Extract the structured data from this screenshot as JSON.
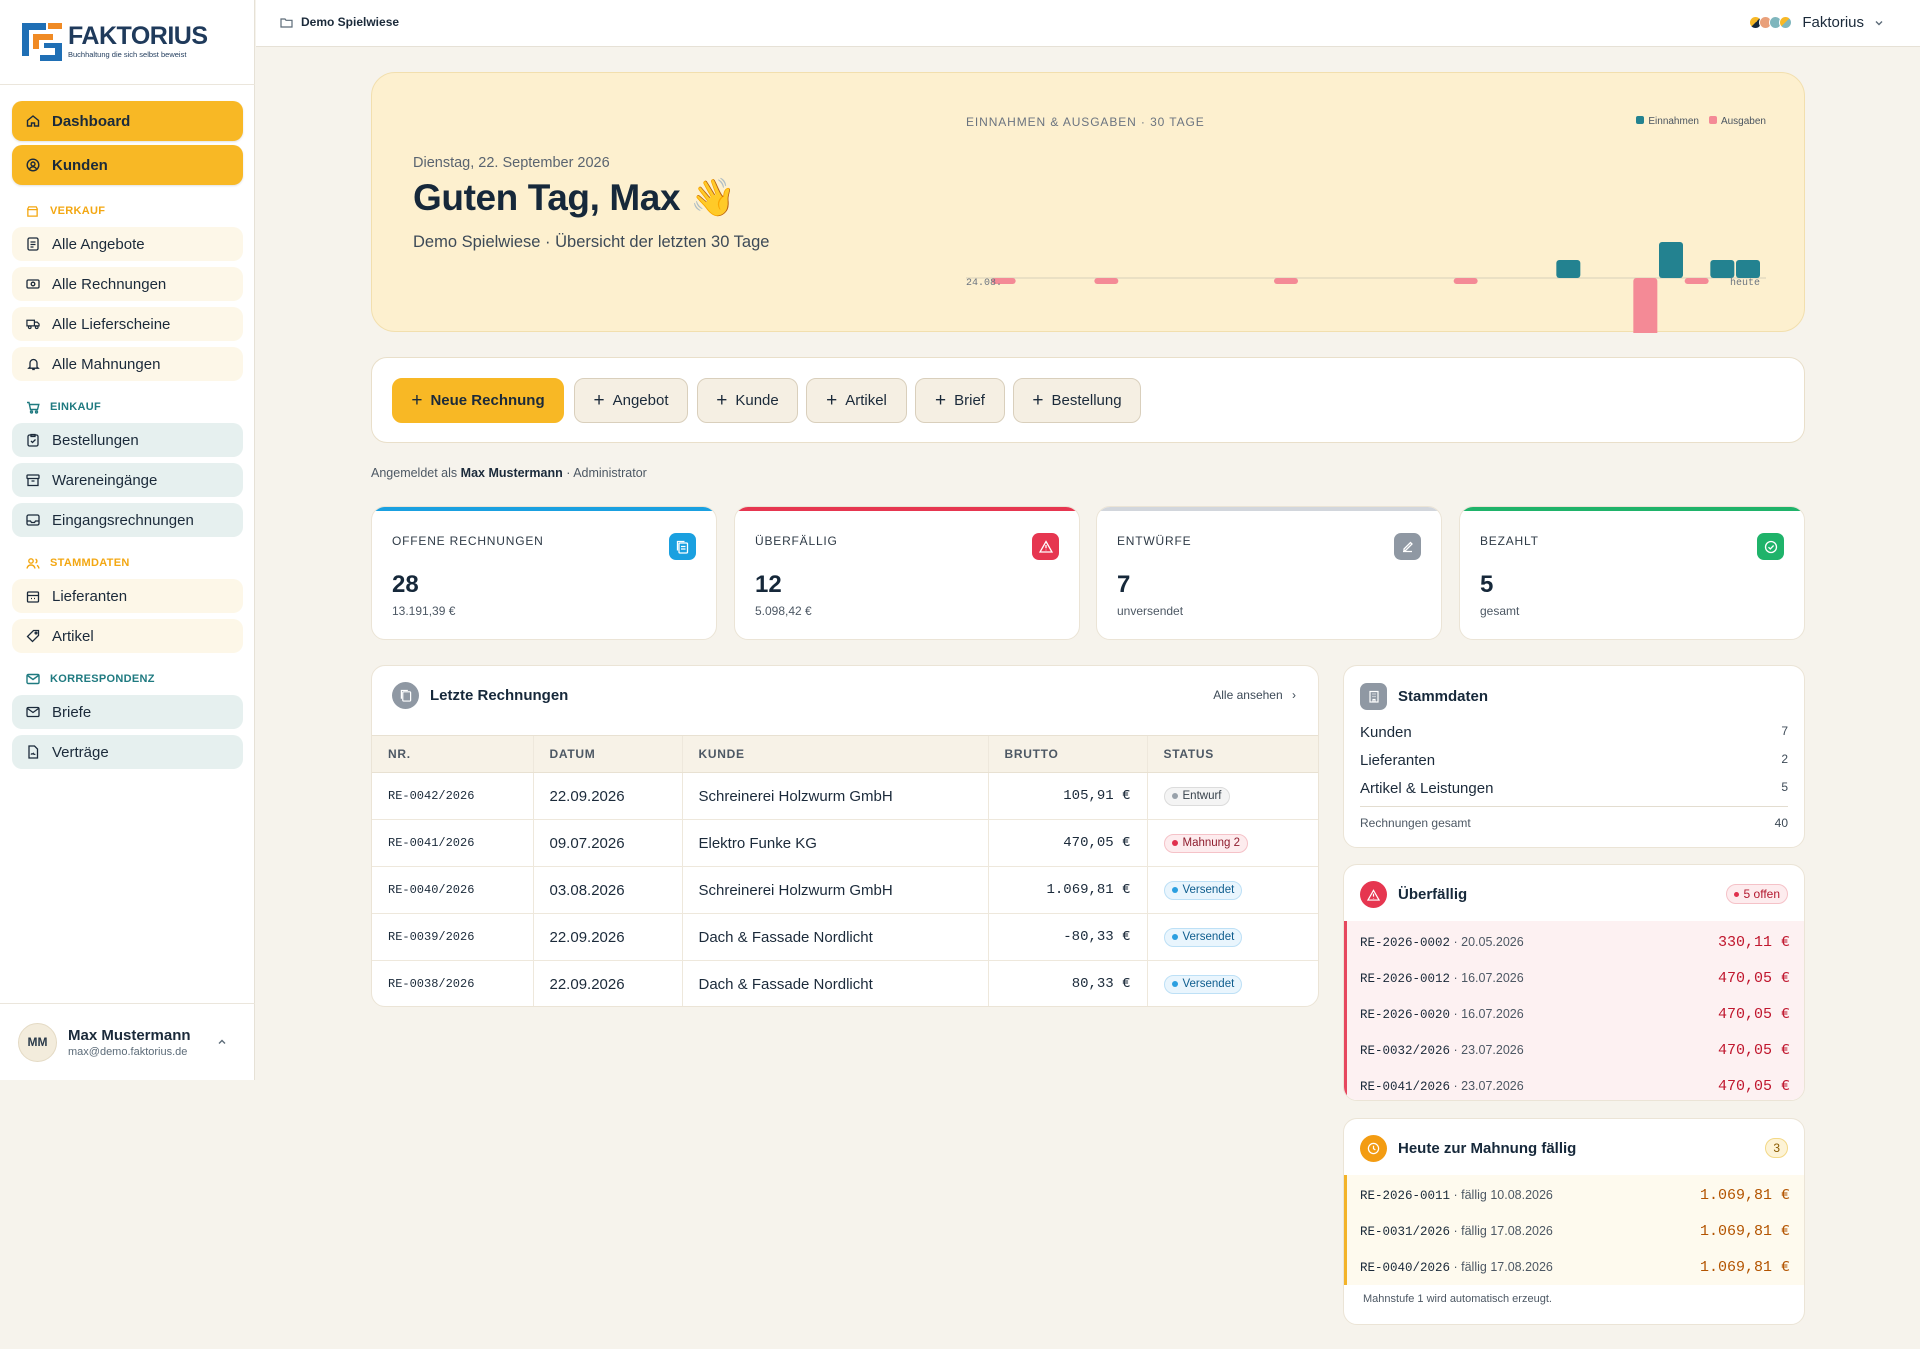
{
  "brand": {
    "name": "FAKTORIUS",
    "tagline": "Buchhaltung die sich selbst beweist"
  },
  "sidebar": {
    "top_items": [
      {
        "label": "Dashboard",
        "icon": "home-icon"
      },
      {
        "label": "Kunden",
        "icon": "user-circle-icon"
      }
    ],
    "sections": [
      {
        "title": "VERKAUF",
        "color": "#f3a712",
        "items": [
          "Alle Angebote",
          "Alle Rechnungen",
          "Alle Lieferscheine",
          "Alle Mahnungen"
        ]
      },
      {
        "title": "EINKAUF",
        "color": "#1f7a80",
        "items": [
          "Bestellungen",
          "Wareneingänge",
          "Eingangsrechnungen"
        ]
      },
      {
        "title": "STAMMDATEN",
        "color": "#f3a712",
        "items": [
          "Lieferanten",
          "Artikel"
        ]
      },
      {
        "title": "KORRESPONDENZ",
        "color": "#1f7a80",
        "items": [
          "Briefe",
          "Verträge"
        ]
      }
    ],
    "user": {
      "initials": "MM",
      "name": "Max Mustermann",
      "email": "max@demo.faktorius.de"
    }
  },
  "topbar": {
    "workspace": "Demo Spielwiese",
    "account": "Faktorius"
  },
  "hero": {
    "date": "Dienstag, 22. September 2026",
    "greeting": "Guten Tag, Max 👋",
    "subtitle": "Demo Spielwiese · Übersicht der letzten 30 Tage",
    "chart_title": "EINNAHMEN & AUSGABEN · 30 TAGE",
    "legend": {
      "income": "Einnahmen",
      "expense": "Ausgaben"
    },
    "x_start": "24.08.",
    "x_end": "heute"
  },
  "chart_data": {
    "type": "bar",
    "title": "EINNAHMEN & AUSGABEN · 30 TAGE",
    "x_range": [
      "24.08.",
      "heute"
    ],
    "days": 31,
    "series": [
      {
        "name": "Einnahmen",
        "color": "#238290",
        "values": [
          0,
          0,
          0,
          0,
          0,
          0,
          0,
          0,
          0,
          0,
          0,
          0,
          0,
          0,
          0,
          0,
          0,
          0,
          0,
          0,
          0,
          0,
          0,
          105.91,
          0,
          0,
          0,
          470.05,
          0,
          80.33,
          105.91
        ]
      },
      {
        "name": "Ausgaben",
        "color": "#f48a96",
        "values": [
          0,
          -15,
          0,
          0,
          0,
          -15,
          0,
          0,
          0,
          0,
          0,
          0,
          -30,
          0,
          0,
          0,
          0,
          0,
          0,
          -15,
          0,
          0,
          0,
          0,
          0,
          0,
          -390,
          0,
          -15,
          0,
          0
        ]
      }
    ]
  },
  "actions": [
    {
      "label": "Neue Rechnung",
      "primary": true
    },
    {
      "label": "Angebot"
    },
    {
      "label": "Kunde"
    },
    {
      "label": "Artikel"
    },
    {
      "label": "Brief"
    },
    {
      "label": "Bestellung"
    }
  ],
  "logged_in": {
    "prefix": "Angemeldet als",
    "name": "Max Mustermann",
    "role": "· Administrator"
  },
  "stats": [
    {
      "label": "OFFENE RECHNUNGEN",
      "value": "28",
      "sub": "13.191,39 €",
      "color": "#1aa0e0",
      "icon": "documents-icon"
    },
    {
      "label": "ÜBERFÄLLIG",
      "value": "12",
      "sub": "5.098,42 €",
      "color": "#e63650",
      "icon": "warning-icon"
    },
    {
      "label": "ENTWÜRFE",
      "value": "7",
      "sub": "unversendet",
      "color": "#8f98a3",
      "icon": "edit-icon"
    },
    {
      "label": "BEZAHLT",
      "value": "5",
      "sub": "gesamt",
      "color": "#1fb36a",
      "icon": "check-circle-icon"
    }
  ],
  "recent": {
    "title": "Letzte Rechnungen",
    "see_all": "Alle ansehen",
    "columns": [
      "NR.",
      "DATUM",
      "KUNDE",
      "BRUTTO",
      "STATUS"
    ],
    "rows": [
      {
        "nr": "RE-0042/2026",
        "date": "22.09.2026",
        "customer": "Schreinerei Holzwurm GmbH",
        "amount": "105,91 €",
        "status": "Entwurf",
        "kind": "gray"
      },
      {
        "nr": "RE-0041/2026",
        "date": "09.07.2026",
        "customer": "Elektro Funke KG",
        "amount": "470,05 €",
        "status": "Mahnung 2",
        "kind": "red"
      },
      {
        "nr": "RE-0040/2026",
        "date": "03.08.2026",
        "customer": "Schreinerei Holzwurm GmbH",
        "amount": "1.069,81 €",
        "status": "Versendet",
        "kind": "blue"
      },
      {
        "nr": "RE-0039/2026",
        "date": "22.09.2026",
        "customer": "Dach & Fassade Nordlicht",
        "amount": "-80,33 €",
        "status": "Versendet",
        "kind": "blue"
      },
      {
        "nr": "RE-0038/2026",
        "date": "22.09.2026",
        "customer": "Dach & Fassade Nordlicht",
        "amount": "80,33 €",
        "status": "Versendet",
        "kind": "blue"
      }
    ]
  },
  "stammdaten": {
    "title": "Stammdaten",
    "items": [
      {
        "label": "Kunden",
        "value": "7"
      },
      {
        "label": "Lieferanten",
        "value": "2"
      },
      {
        "label": "Artikel & Leistungen",
        "value": "5"
      }
    ],
    "total_label": "Rechnungen gesamt",
    "total_value": "40"
  },
  "overdue": {
    "title": "Überfällig",
    "badge": "5 offen",
    "rows": [
      {
        "nr": "RE-2026-0002",
        "date": "· 20.05.2026",
        "amount": "330,11 €"
      },
      {
        "nr": "RE-2026-0012",
        "date": "· 16.07.2026",
        "amount": "470,05 €"
      },
      {
        "nr": "RE-2026-0020",
        "date": "· 16.07.2026",
        "amount": "470,05 €"
      },
      {
        "nr": "RE-0032/2026",
        "date": "· 23.07.2026",
        "amount": "470,05 €"
      },
      {
        "nr": "RE-0041/2026",
        "date": "· 23.07.2026",
        "amount": "470,05 €"
      }
    ]
  },
  "dunning": {
    "title": "Heute zur Mahnung fällig",
    "count": "3",
    "rows": [
      {
        "nr": "RE-2026-0011",
        "date": "· fällig 10.08.2026",
        "amount": "1.069,81 €"
      },
      {
        "nr": "RE-0031/2026",
        "date": "· fällig 17.08.2026",
        "amount": "1.069,81 €"
      },
      {
        "nr": "RE-0040/2026",
        "date": "· fällig 17.08.2026",
        "amount": "1.069,81 €"
      }
    ],
    "note": "Mahnstufe 1 wird automatisch erzeugt."
  }
}
